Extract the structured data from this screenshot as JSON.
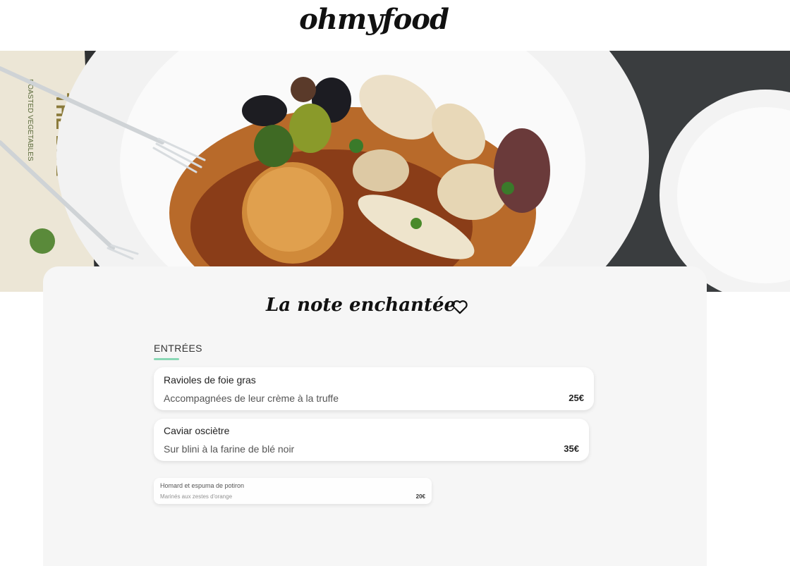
{
  "brand": {
    "logo_text": "ohmyfood"
  },
  "hero": {
    "image": "seafood-plate-photo"
  },
  "restaurant": {
    "name": "La note enchantée",
    "like_icon": "heart-outline-icon"
  },
  "menu": {
    "section_label": "ENTRÉES",
    "accent_color": "#8ad7b5",
    "dishes": [
      {
        "name": "Ravioles de foie gras",
        "description": "Accompagnées de leur crème à la truffe",
        "price": "25€"
      },
      {
        "name": "Caviar osciètre",
        "description": "Sur blini à la farine de blé noir",
        "price": "35€"
      },
      {
        "name": "Homard et espuma de potiron",
        "description": "Marinés aux zestes d'orange",
        "price": "20€"
      }
    ]
  }
}
